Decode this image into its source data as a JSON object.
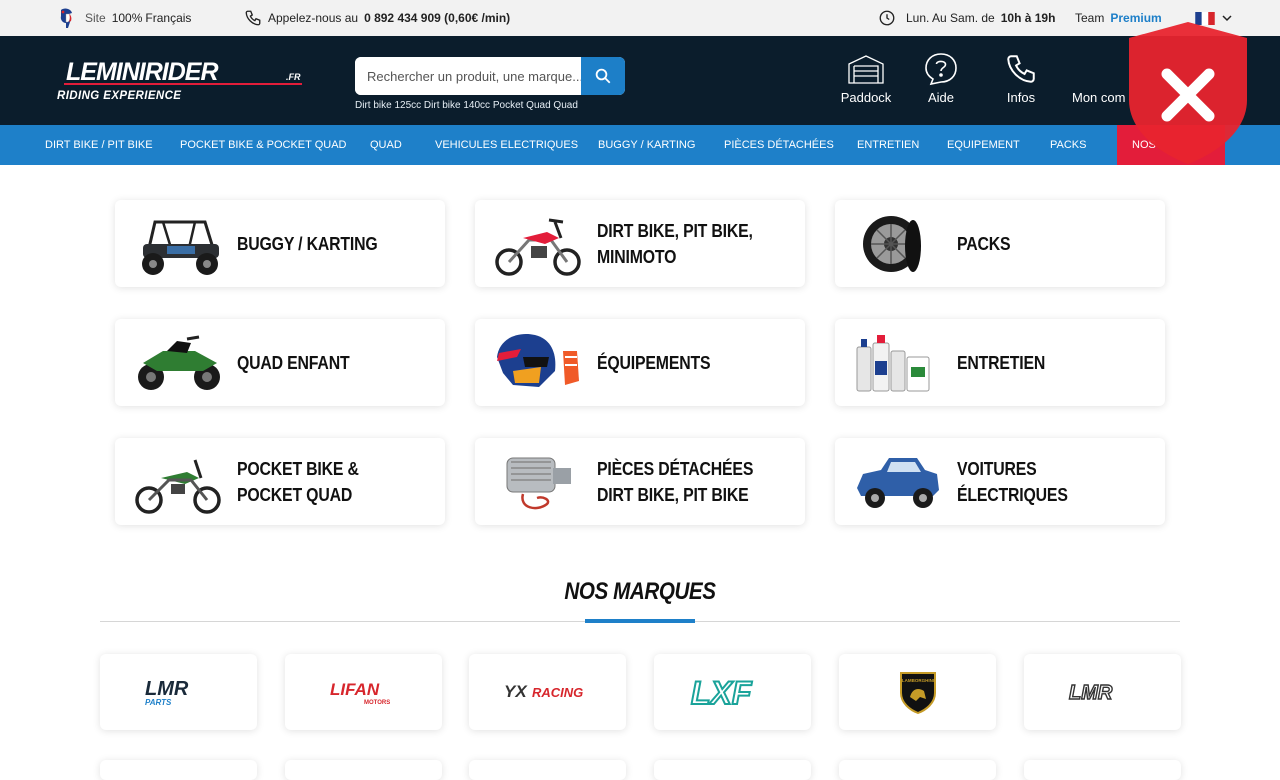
{
  "topbar": {
    "site_prefix": "Site",
    "site_highlight": "100%",
    "site_suffix": "Français",
    "phone_prefix": "Appelez-nous au",
    "phone_number": "0 892 434 909 (0,60€ /min)",
    "hours_prefix": "Lun. Au Sam. de",
    "hours_value": "10h à 19h",
    "team_prefix": "Team",
    "team_highlight": "Premium",
    "language": "FR"
  },
  "header": {
    "logo_text": "LEMINIRIDER",
    "logo_tld": ".FR",
    "logo_tagline": "RIDING EXPERIENCE",
    "search_placeholder": "Rechercher un produit, une marque...",
    "search_suggestions": "Dirt bike 125cc Dirt bike 140cc Pocket Quad Quad",
    "icons": [
      {
        "label": "Paddock",
        "icon": "garage-icon"
      },
      {
        "label": "Aide",
        "icon": "help-icon"
      },
      {
        "label": "Infos",
        "icon": "phone-icon"
      },
      {
        "label": "Mon com",
        "icon": "account-icon"
      }
    ]
  },
  "nav": {
    "items": [
      "DIRT BIKE / PIT BIKE",
      "POCKET BIKE & POCKET QUAD",
      "QUAD",
      "VEHICULES ELECTRIQUES",
      "BUGGY / KARTING",
      "PIÈCES DÉTACHÉES",
      "ENTRETIEN",
      "EQUIPEMENT",
      "PACKS",
      "NOS"
    ]
  },
  "categories": [
    {
      "label": "BUGGY / KARTING",
      "icon": "buggy-icon"
    },
    {
      "label": "DIRT BIKE, PIT BIKE, MINIMOTO",
      "icon": "dirt-bike-icon"
    },
    {
      "label": "PACKS",
      "icon": "wheels-icon"
    },
    {
      "label": "QUAD ENFANT",
      "icon": "quad-icon"
    },
    {
      "label": "ÉQUIPEMENTS",
      "icon": "helmet-icon"
    },
    {
      "label": "ENTRETIEN",
      "icon": "oil-bottles-icon"
    },
    {
      "label": "POCKET BIKE & POCKET QUAD",
      "icon": "pocket-bike-icon"
    },
    {
      "label": "PIÈCES DÉTACHÉES DIRT BIKE, PIT BIKE",
      "icon": "engine-icon"
    },
    {
      "label": "VOITURES ÉLECTRIQUES",
      "icon": "electric-car-icon"
    }
  ],
  "brands": {
    "title": "NOS MARQUES",
    "items": [
      {
        "name": "LMR",
        "sub": "PARTS",
        "color": "#1e80c9"
      },
      {
        "name": "LIFAN",
        "sub": "MOTORS",
        "color": "#d7262c"
      },
      {
        "name": "YX",
        "sub": "RACING",
        "color": "#333333"
      },
      {
        "name": "LXF",
        "sub": "",
        "color": "#1aa39a"
      },
      {
        "name": "LAMBORGHINI",
        "sub": "",
        "color": "#c59b27"
      },
      {
        "name": "LMR",
        "sub": "",
        "color": "#333333"
      }
    ]
  },
  "colors": {
    "topbar_bg": "#f2f2f2",
    "header_bg": "#0b1d2c",
    "nav_bg": "#1e80c9",
    "accent_red": "#e31d3a",
    "brand_blue": "#1d7fc8"
  }
}
